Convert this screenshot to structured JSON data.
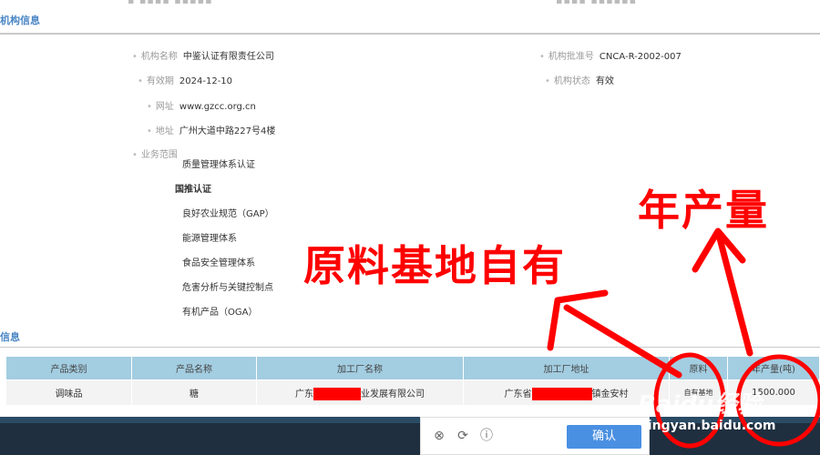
{
  "colors": {
    "accent": "#4a86c5",
    "table_header": "#a3cde1",
    "annotation": "#ff0000",
    "confirm": "#4a90e2"
  },
  "org_section": {
    "title": "机构信息",
    "fields_left": [
      {
        "label": "机构名称",
        "value": "中鉴认证有限责任公司"
      },
      {
        "label": "有效期",
        "value": "2024-12-10"
      },
      {
        "label": "网址",
        "value": "www.gzcc.org.cn"
      },
      {
        "label": "地址",
        "value": "广州大道中路227号4楼"
      }
    ],
    "fields_right": [
      {
        "label": "机构批准号",
        "value": "CNCA-R-2002-007"
      },
      {
        "label": "机构状态",
        "value": "有效"
      }
    ],
    "scope_label": "业务范围",
    "scope_items": [
      "质量管理体系认证",
      "国推认证",
      "良好农业规范（GAP）",
      "能源管理体系",
      "食品安全管理体系",
      "危害分析与关键控制点",
      "有机产品（OGA）"
    ]
  },
  "product_section": {
    "title": "信息",
    "headers": [
      "产品类别",
      "产品名称",
      "加工厂名称",
      "加工厂地址",
      "原料",
      "年产量(吨)"
    ],
    "row": {
      "category": "调味品",
      "name": "糖",
      "factory_prefix": "广东",
      "factory_suffix": "业发展有限公司",
      "address_prefix": "广东省",
      "address_suffix": "镇金安村",
      "material": "自有基地",
      "output": "1500.000"
    }
  },
  "popup": {
    "confirm_label": "确认",
    "icons": [
      "close-circle-icon",
      "refresh-icon",
      "info-icon"
    ]
  },
  "annotations": {
    "left": "原料基地自有",
    "right": "年产量"
  },
  "watermark": {
    "logo": "Baidu经验",
    "url": "jingyan.baidu.com"
  }
}
